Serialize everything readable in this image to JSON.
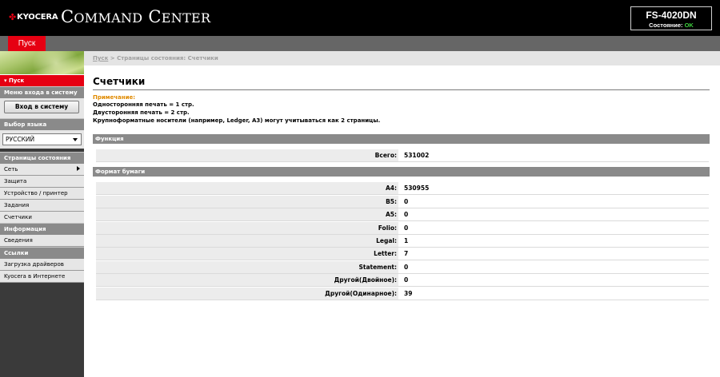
{
  "header": {
    "brand_logo": "KYOCERA",
    "app_title_main": "C",
    "app_title_rest1": "OMMAND",
    "app_title_c2": " C",
    "app_title_rest2": "ENTER",
    "device_model": "FS-4020DN",
    "status_label": "Состояние:",
    "status_value": "OK"
  },
  "tabs": {
    "start": "Пуск"
  },
  "sidebar": {
    "active_item": "▾ Пуск",
    "login_menu_header": "Меню входа в систему",
    "login_button": "Вход в систему",
    "language_header": "Выбор языка",
    "language_selected": "РУССКИЙ",
    "status_pages_header": "Страницы состояния",
    "status_items": [
      "Сеть",
      "Защита",
      "Устройство / принтер",
      "Задания",
      "Счетчики"
    ],
    "info_header": "Информация",
    "info_items": [
      "Сведения"
    ],
    "links_header": "Ссылки",
    "links_items": [
      "Загрузка драйверов",
      "Kyocera в Интернете"
    ]
  },
  "breadcrumb": {
    "home": "Пуск",
    "separator": " > ",
    "current": "Страницы состояния: Счетчики"
  },
  "page": {
    "title": "Счетчики",
    "note_label": "Примечание:",
    "note_lines": [
      "Односторонняя печать = 1 стр.",
      "Двусторонняя печать = 2 стр.",
      "Крупноформатные носители (например, Ledger, A3) могут учитываться как 2 страницы."
    ]
  },
  "sections": {
    "function": {
      "header": "Функция",
      "rows": [
        {
          "label": "Всего:",
          "value": "531002"
        }
      ]
    },
    "paper_format": {
      "header": "Формат бумаги",
      "rows": [
        {
          "label": "A4:",
          "value": "530955"
        },
        {
          "label": "B5:",
          "value": "0"
        },
        {
          "label": "A5:",
          "value": "0"
        },
        {
          "label": "Folio:",
          "value": "0"
        },
        {
          "label": "Legal:",
          "value": "1"
        },
        {
          "label": "Letter:",
          "value": "7"
        },
        {
          "label": "Statement:",
          "value": "0"
        },
        {
          "label": "Другой(Двойное):",
          "value": "0"
        },
        {
          "label": "Другой(Одинарное):",
          "value": "39"
        }
      ]
    }
  },
  "colors": {
    "accent_red": "#e60012",
    "status_ok": "#3fd23f",
    "note_orange": "#e08a00",
    "section_gray": "#8a8a8a"
  }
}
